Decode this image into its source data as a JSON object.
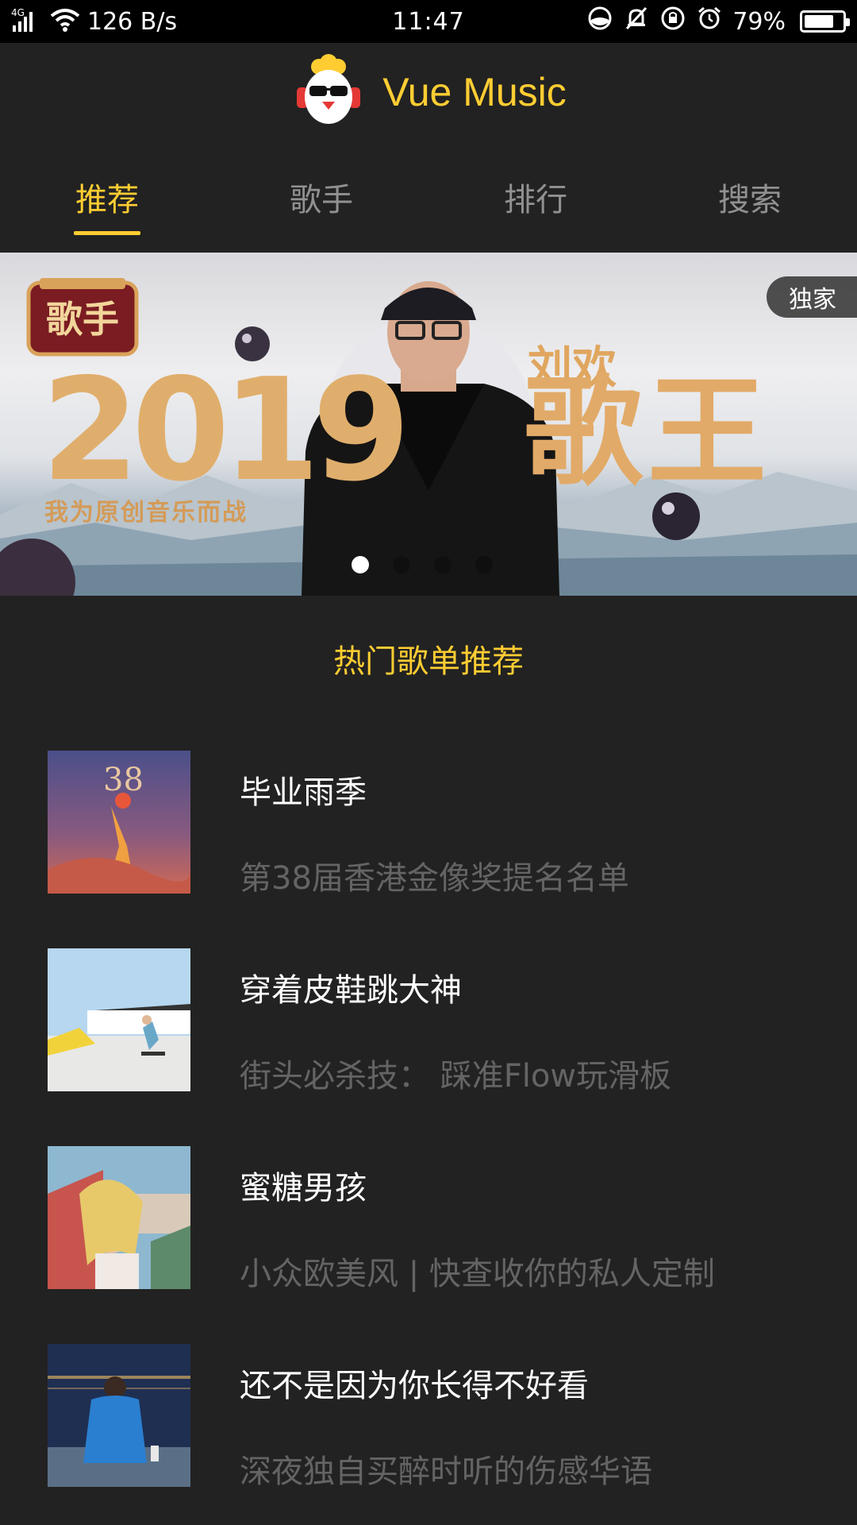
{
  "status_bar": {
    "network": "4G",
    "net_speed": "126 B/s",
    "time": "11:47",
    "battery": "79%",
    "battery_level": 0.79
  },
  "header": {
    "title": "Vue Music",
    "logo_icon": "rooster-with-sunglasses-icon"
  },
  "tabs": [
    {
      "label": "推荐",
      "active": true
    },
    {
      "label": "歌手",
      "active": false
    },
    {
      "label": "排行",
      "active": false
    },
    {
      "label": "搜索",
      "active": false
    }
  ],
  "banner": {
    "badge": "独家",
    "year": "2019",
    "slogan": "我为原创音乐而战",
    "artist": "刘欢",
    "headline": "歌王",
    "show_logo_text": "歌手",
    "slides": 4,
    "active_slide": 1
  },
  "section_title": "热门歌单推荐",
  "playlists": [
    {
      "name": "毕业雨季",
      "desc": "第38届香港金像奖提名名单"
    },
    {
      "name": "穿着皮鞋跳大神",
      "desc": "街头必杀技： 踩准Flow玩滑板"
    },
    {
      "name": "蜜糖男孩",
      "desc": "小众欧美风 | 快查收你的私人定制"
    },
    {
      "name": "还不是因为你长得不好看",
      "desc": "深夜独自买醉时听的伤感华语"
    }
  ],
  "colors": {
    "accent": "#ffcd32",
    "background": "#222222"
  }
}
